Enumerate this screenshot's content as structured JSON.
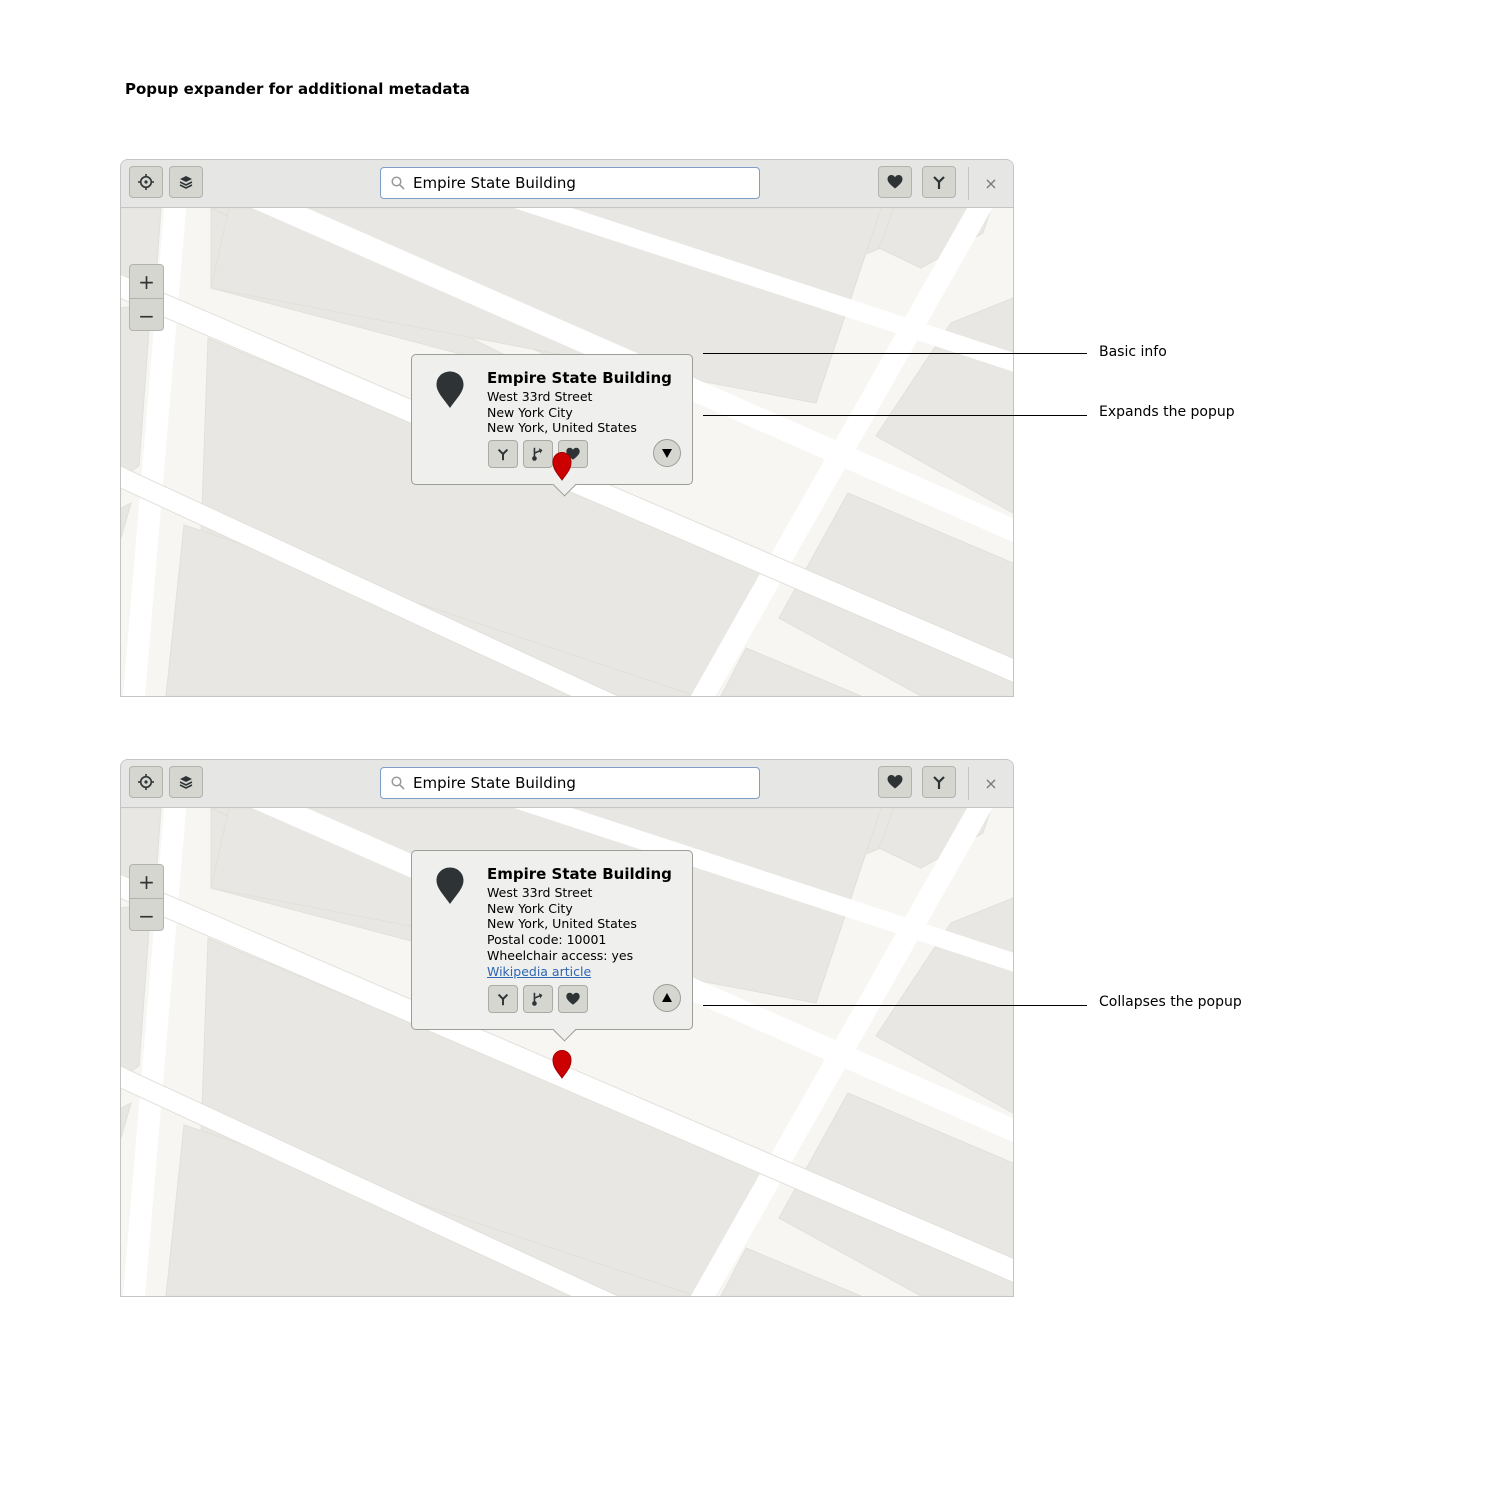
{
  "page": {
    "title": "Popup expander for additional metadata"
  },
  "colors": {
    "marker": "#cc0000",
    "headerbar": "#e6e6e4",
    "link": "#2e66b5",
    "map_block": "#e8e7e3",
    "map_sidewalk": "#f8f6f2",
    "map_road": "#ffffff"
  },
  "icons": {
    "locate": "crosshair-icon",
    "layers": "layers-icon",
    "search": "search-icon",
    "favorites": "heart-icon",
    "route": "route-icon",
    "route_from": "route-from-here-icon",
    "close": "close-icon",
    "poi": "map-pin-icon",
    "expand": "triangle-down-icon",
    "collapse": "triangle-up-icon"
  },
  "windows": [
    {
      "search": {
        "value": "Empire State Building"
      },
      "zoom": {
        "in_label": "+",
        "out_label": "−"
      },
      "close_label": "×",
      "popup": {
        "expanded": false,
        "name": "Empire State Building",
        "lines": [
          "West 33rd Street",
          "New York City",
          "New York, United States"
        ]
      }
    },
    {
      "search": {
        "value": "Empire State Building"
      },
      "zoom": {
        "in_label": "+",
        "out_label": "−"
      },
      "close_label": "×",
      "popup": {
        "expanded": true,
        "name": "Empire State Building",
        "lines": [
          "West 33rd Street",
          "New York City",
          "New York, United States",
          "Postal code: 10001",
          "Wheelchair access: yes"
        ],
        "link": "Wikipedia article"
      }
    }
  ],
  "annotations": {
    "basic_info": "Basic info",
    "expands": "Expands the popup",
    "collapses": "Collapses the popup"
  }
}
